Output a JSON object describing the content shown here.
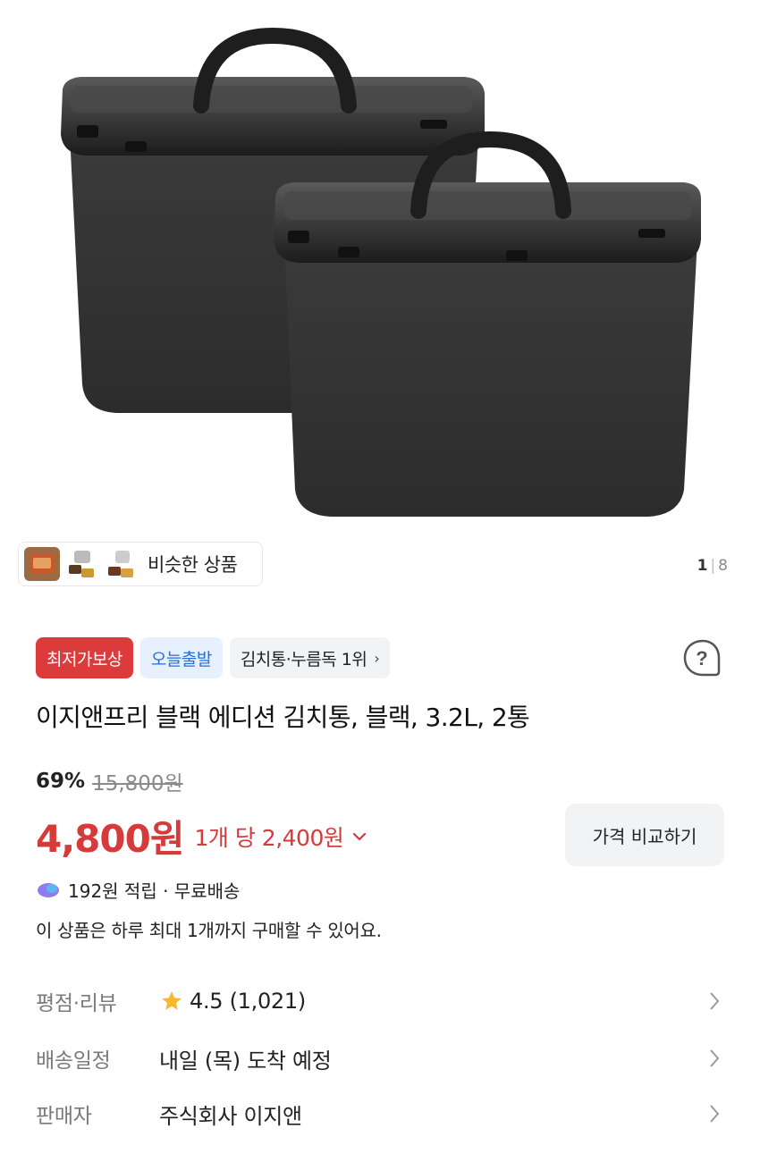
{
  "similar": {
    "label": "비슷한 상품"
  },
  "gallery": {
    "current": "1",
    "separator": "|",
    "total": "8"
  },
  "badges": [
    {
      "label": "최저가보상"
    },
    {
      "label": "오늘출발"
    },
    {
      "label": "김치통·누름독 1위"
    }
  ],
  "product": {
    "title": "이지앤프리 블랙 에디션 김치통, 블랙, 3.2L, 2통",
    "discount_percent": "69%",
    "original_price": "15,800원",
    "price": "4,800원",
    "unit_price": "1개 당 2,400원",
    "compare_label": "가격 비교하기",
    "reward": "192원 적립 · 무료배송",
    "purchase_limit": "이 상품은 하루 최대 1개까지 구매할 수 있어요."
  },
  "info": {
    "rating": {
      "label": "평점·리뷰",
      "value": "4.5 (1,021)"
    },
    "delivery": {
      "label": "배송일정",
      "value": "내일 (목) 도착 예정"
    },
    "seller": {
      "label": "판매자",
      "value": "주식회사 이지앤"
    }
  },
  "colors": {
    "accent_red": "#dc3b3b",
    "price_red": "#d63a3a",
    "badge_blue": "#2b6cd9",
    "star": "#f5b82e"
  },
  "icons": [
    "help-icon",
    "reward-icon",
    "star-icon",
    "chevron-right-icon",
    "chevron-down-icon"
  ]
}
